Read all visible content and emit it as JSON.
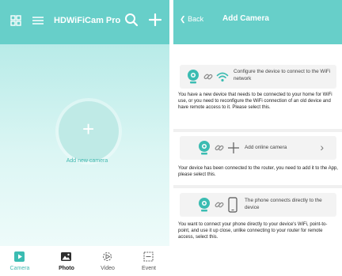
{
  "left": {
    "app_title": "HDWiFiCam Pro",
    "add_label": "Add new camera",
    "tabs": [
      {
        "label": "Camera",
        "icon": "camera-tab-icon",
        "active": true
      },
      {
        "label": "Photo",
        "icon": "photo-tab-icon",
        "active": false
      },
      {
        "label": "Video",
        "icon": "video-tab-icon",
        "active": false
      },
      {
        "label": "Event",
        "icon": "event-tab-icon",
        "active": false
      }
    ]
  },
  "right": {
    "back": "Back",
    "title": "Add Camera",
    "options": [
      {
        "text": "Configure the device to connect to the WiFi network"
      },
      {
        "text": "Add online camera"
      },
      {
        "text": "The phone connects directly to the device"
      }
    ],
    "descriptions": [
      "You have a new device that needs to be connected to your home for WiFi use, or you need to reconfigure the WiFi connection of an old device and have remote access to it. Please select this.",
      "Your device has been connected to the router, you need to add it to the App, please select this.",
      "You want to connect your phone directly to your device's WiFi, point-to-point, and use it up close, unlike connecting to your router for remote access, select this."
    ]
  },
  "colors": {
    "accent": "#67cfc9",
    "accent_dark": "#44b9b0"
  }
}
